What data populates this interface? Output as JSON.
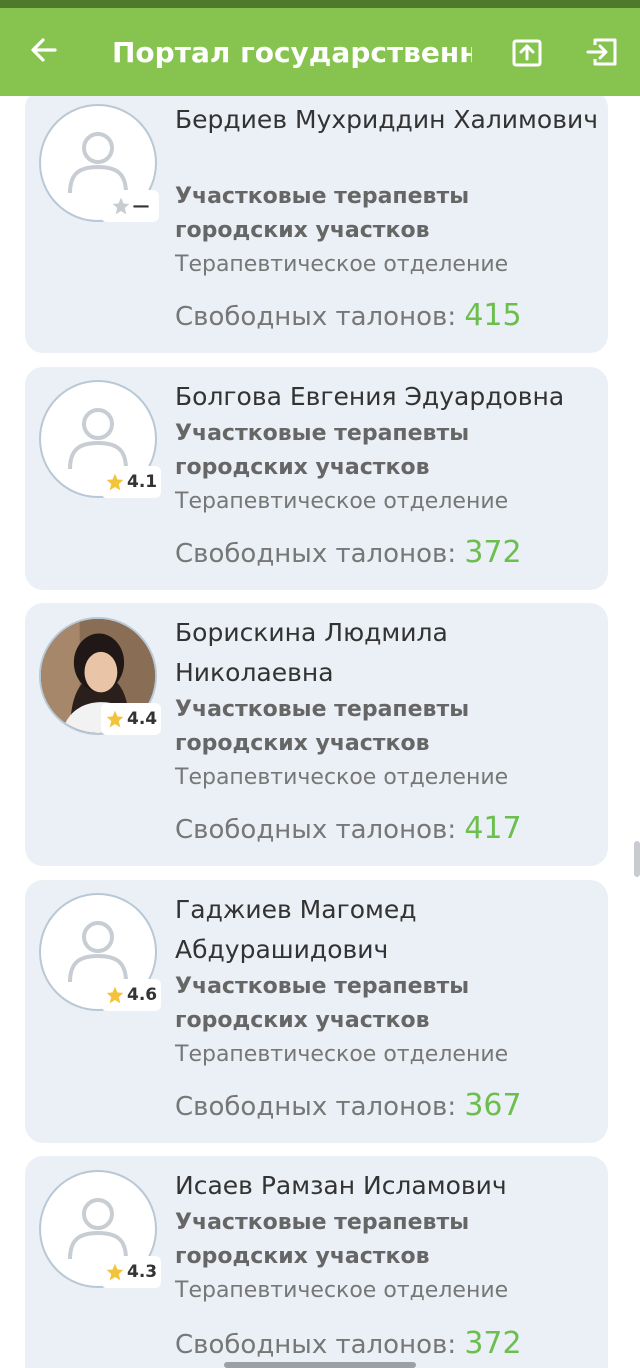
{
  "app_bar": {
    "title": "Портал государственн...",
    "color": "#86c44f",
    "back_icon": "arrow-left-icon",
    "share_icon": "share-box-icon",
    "logout_icon": "logout-icon"
  },
  "free_label": "Свободных талонов: ",
  "doctors": [
    {
      "name": "Бердиев Мухриддин Халимович",
      "specialty": "Участковые терапевты городских участков",
      "department": "Терапевтическое отделение",
      "free_count": "415",
      "rating": "—",
      "photo": false
    },
    {
      "name": "Болгова Евгения Эдуардовна",
      "specialty": "Участковые терапевты городских участков",
      "department": "Терапевтическое отделение",
      "free_count": "372",
      "rating": "4.1",
      "photo": false
    },
    {
      "name": "Борискина Людмила Николаевна",
      "specialty": "Участковые терапевты городских участков",
      "department": "Терапевтическое отделение",
      "free_count": "417",
      "rating": "4.4",
      "photo": true
    },
    {
      "name": "Гаджиев Магомед Абдурашидович",
      "specialty": "Участковые терапевты городских участков",
      "department": "Терапевтическое отделение",
      "free_count": "367",
      "rating": "4.6",
      "photo": false
    },
    {
      "name": "Исаев Рамзан Исламович",
      "specialty": "Участковые терапевты городских участков",
      "department": "Терапевтическое отделение",
      "free_count": "372",
      "rating": "4.3",
      "photo": false
    }
  ]
}
